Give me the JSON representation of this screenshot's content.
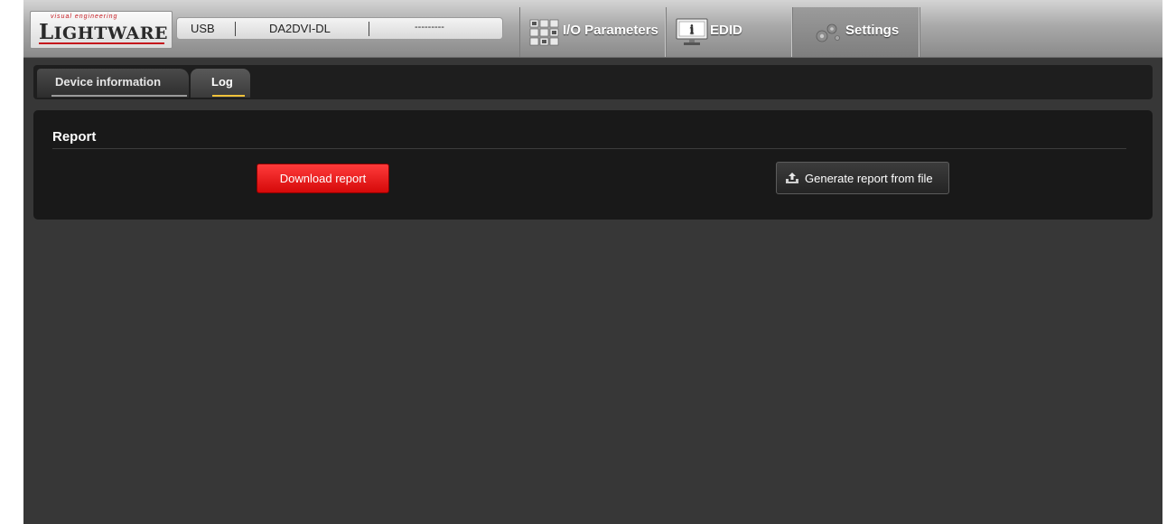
{
  "header": {
    "logo": {
      "tagline": "visual engineering",
      "wordmark": "LIGHTWARE"
    },
    "connection": {
      "port": "USB",
      "device": "DA2DVI-DL",
      "serial": "---------"
    },
    "main_tabs": [
      {
        "label": "I/O Parameters",
        "icon": "io-grid-icon"
      },
      {
        "label": "EDID",
        "icon": "monitor-info-icon"
      },
      {
        "label": "Settings",
        "icon": "gears-icon",
        "active": true
      }
    ]
  },
  "subtabs": [
    {
      "label": "Device information"
    },
    {
      "label": "Log",
      "active": true
    }
  ],
  "report": {
    "title": "Report",
    "download_label": "Download report",
    "generate_label": "Generate report from file",
    "generate_icon": "upload-tray-icon"
  },
  "colors": {
    "accent_red": "#e01010",
    "active_underline": "#f0c23a",
    "background": "#373737",
    "panel": "#191919"
  }
}
